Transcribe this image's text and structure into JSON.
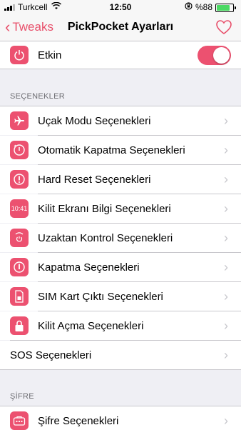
{
  "status_bar": {
    "carrier": "Turkcell",
    "time": "12:50",
    "battery_percent": "%88",
    "battery_level": 0.88
  },
  "nav": {
    "back_label": "Tweaks",
    "title": "PickPocket Ayarları",
    "accent_color": "#e8506b"
  },
  "enabled_row": {
    "label": "Etkin",
    "toggle_on": true,
    "icon": "power-icon"
  },
  "options_section": {
    "header": "SEÇENEKLER",
    "items": [
      {
        "label": "Uçak Modu Seçenekleri",
        "icon": "airplane-icon"
      },
      {
        "label": "Otomatik Kapatma Seçenekleri",
        "icon": "auto-power-icon"
      },
      {
        "label": "Hard Reset Seçenekleri",
        "icon": "alert-icon"
      },
      {
        "label": "Kilit Ekranı Bilgi Seçenekleri",
        "icon": "clock-display-icon",
        "icon_text": "10:41"
      },
      {
        "label": "Uzaktan Kontrol Seçenekleri",
        "icon": "remote-power-icon"
      },
      {
        "label": "Kapatma Seçenekleri",
        "icon": "power-off-icon"
      },
      {
        "label": "SIM Kart Çıktı Seçenekleri",
        "icon": "sim-card-icon"
      },
      {
        "label": "Kilit Açma Seçenekleri",
        "icon": "lock-icon"
      },
      {
        "label": "SOS Seçenekleri"
      }
    ]
  },
  "password_section": {
    "header": "ŞİFRE",
    "items": [
      {
        "label": "Şifre Seçenekleri",
        "icon": "password-icon"
      }
    ]
  }
}
